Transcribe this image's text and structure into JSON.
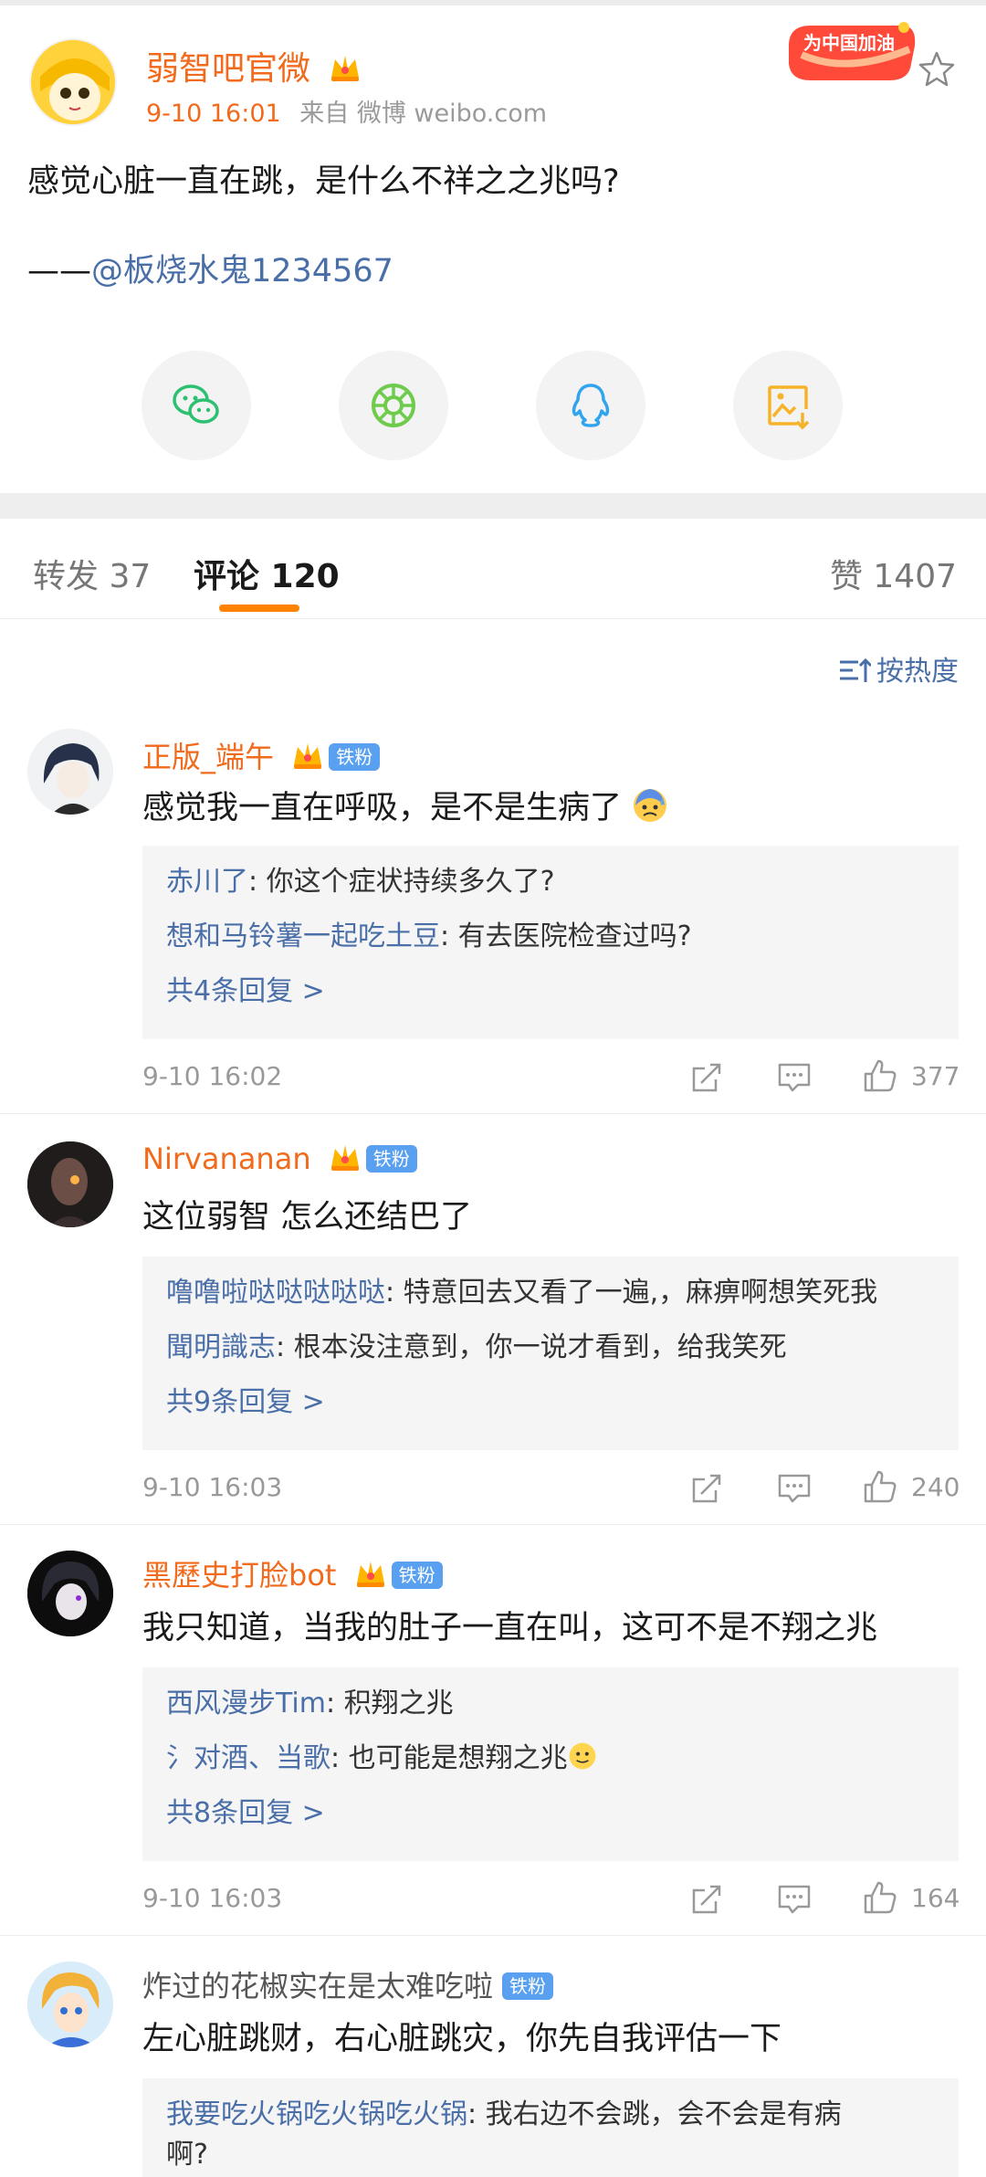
{
  "post": {
    "author": "弱智吧官微",
    "time": "9-10 16:01",
    "source": "来自 微博 weibo.com",
    "badge_text": "为中国加油",
    "text": "感觉心脏一直在跳，是什么不祥之之兆吗?",
    "sub_prefix": "——",
    "sub_mention": "@板烧水鬼1234567"
  },
  "share": [
    "wechat-icon",
    "moments-icon",
    "qq-icon",
    "save-image-icon"
  ],
  "tabs": {
    "repost": "转发 37",
    "comment": "评论 120",
    "like": "赞 1407"
  },
  "sort_label": "按热度",
  "comments": [
    {
      "name": "正版_端午",
      "fan_badge": "铁粉",
      "text": "感觉我一直在呼吸，是不是生病了",
      "replies": [
        {
          "user": "赤川了",
          "text": ": 你这个症状持续多久了?"
        },
        {
          "user": "想和马铃薯一起吃土豆",
          "text": ": 有去医院检查过吗?"
        }
      ],
      "more": "共4条回复 >",
      "time": "9-10 16:02",
      "likes": "377"
    },
    {
      "name": "Nirvananan",
      "fan_badge": "铁粉",
      "text": "这位弱智 怎么还结巴了",
      "replies": [
        {
          "user": "噜噜啦哒哒哒哒哒",
          "text": ": 特意回去又看了一遍,，麻痹啊想笑死我"
        },
        {
          "user": "聞明識志",
          "text": ": 根本没注意到，你一说才看到，给我笑死"
        }
      ],
      "more": "共9条回复 >",
      "time": "9-10 16:03",
      "likes": "240"
    },
    {
      "name": "黑歷史打脸bot",
      "fan_badge": "铁粉",
      "text": "我只知道，当我的肚子一直在叫，这可不是不翔之兆",
      "replies": [
        {
          "user": "西风漫步Tim",
          "text": ": 积翔之兆"
        },
        {
          "user": "氵对酒、当歌",
          "text": ": 也可能是想翔之兆"
        }
      ],
      "more": "共8条回复 >",
      "time": "9-10 16:03",
      "likes": "164"
    },
    {
      "name": "炸过的花椒实在是太难吃啦",
      "fan_badge": "铁粉",
      "text": "左心脏跳财，右心脏跳灾，你先自我评估一下",
      "replies": [
        {
          "user": "我要吃火锅吃火锅吃火锅",
          "text": ": 我右边不会跳，会不会是有病"
        }
      ],
      "reply_cont": "啊?"
    }
  ]
}
